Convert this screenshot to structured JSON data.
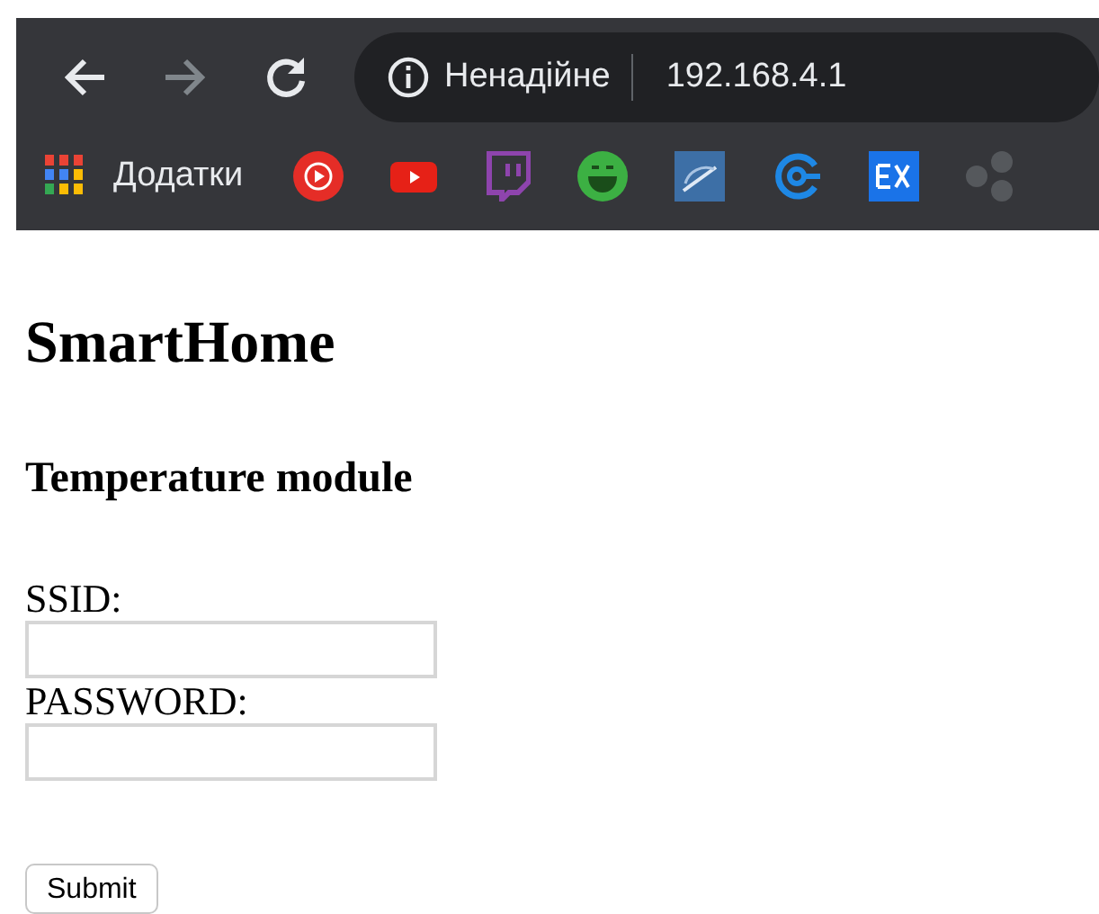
{
  "browser": {
    "back": {
      "disabled": false
    },
    "forward": {
      "disabled": true
    },
    "security_label": "Ненадійне",
    "url": "192.168.4.1",
    "bookmarks": {
      "apps_label": "Додатки"
    }
  },
  "page": {
    "title": "SmartHome",
    "subtitle": "Temperature module",
    "fields": [
      {
        "label": "SSID:"
      },
      {
        "label": "PASSWORD:"
      }
    ],
    "submit": "Submit"
  }
}
